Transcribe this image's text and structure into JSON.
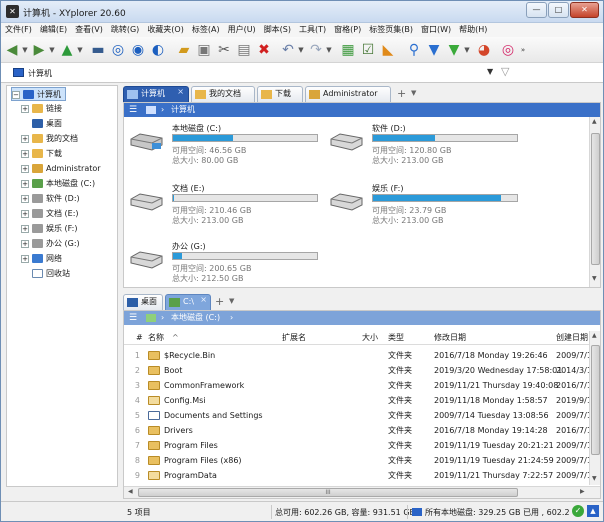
{
  "window": {
    "title": "计算机 - XYplorer 20.60",
    "min": "—",
    "max": "□",
    "close": "✕"
  },
  "menu": [
    "文件(F)",
    "编辑(E)",
    "查看(V)",
    "跳转(G)",
    "收藏夹(O)",
    "标签(A)",
    "用户(U)",
    "脚本(S)",
    "工具(T)",
    "窗格(P)",
    "标签页集(B)",
    "窗口(W)",
    "帮助(H)"
  ],
  "address": {
    "text": "计算机",
    "dropdown": "▼",
    "filter_icon": "funnel-icon"
  },
  "tree": [
    {
      "label": "计算机",
      "icon": "computer-icon",
      "exp": "−"
    },
    {
      "label": "链接",
      "icon": "link-folder-icon",
      "exp": "+"
    },
    {
      "label": "桌面",
      "icon": "desktop-icon",
      "exp": ""
    },
    {
      "label": "我的文档",
      "icon": "documents-icon",
      "exp": "+"
    },
    {
      "label": "下载",
      "icon": "downloads-icon",
      "exp": "+"
    },
    {
      "label": "Administrator",
      "icon": "user-folder-icon",
      "exp": "+"
    },
    {
      "label": "本地磁盘 (C:)",
      "icon": "system-drive-icon",
      "exp": "+"
    },
    {
      "label": "软件 (D:)",
      "icon": "drive-icon",
      "exp": "+"
    },
    {
      "label": "文档 (E:)",
      "icon": "drive-icon",
      "exp": "+"
    },
    {
      "label": "娱乐 (F:)",
      "icon": "drive-icon",
      "exp": "+"
    },
    {
      "label": "办公 (G:)",
      "icon": "drive-icon",
      "exp": "+"
    },
    {
      "label": "网络",
      "icon": "network-icon",
      "exp": "+"
    },
    {
      "label": "回收站",
      "icon": "recycle-bin-icon",
      "exp": ""
    }
  ],
  "pane1": {
    "tabs": [
      {
        "label": "计算机",
        "close": "×"
      },
      {
        "label": "我的文档"
      },
      {
        "label": "下载"
      },
      {
        "label": "Administrator"
      }
    ],
    "tab_add": "+",
    "tab_menu": "▼",
    "breadcrumb": "计算机",
    "drives": [
      {
        "name": "本地磁盘 (C:)",
        "fill": 0.42,
        "free": "可用空间: 46.56 GB",
        "total": "总大小: 80.00 GB"
      },
      {
        "name": "软件 (D:)",
        "fill": 0.43,
        "free": "可用空间: 120.80 GB",
        "total": "总大小: 213.00 GB"
      },
      {
        "name": "文档 (E:)",
        "fill": 0.01,
        "free": "可用空间: 210.46 GB",
        "total": "总大小: 213.00 GB"
      },
      {
        "name": "娱乐 (F:)",
        "fill": 0.89,
        "free": "可用空间: 23.79 GB",
        "total": "总大小: 213.00 GB"
      },
      {
        "name": "办公 (G:)",
        "fill": 0.06,
        "free": "可用空间: 200.65 GB",
        "total": "总大小: 212.50 GB"
      }
    ]
  },
  "pane2": {
    "tabs": [
      {
        "label": "桌面"
      },
      {
        "label": "C:\\",
        "close": "×"
      }
    ],
    "tab_add": "+",
    "tab_menu": "▼",
    "breadcrumb": "本地磁盘 (C:)",
    "columns": {
      "num": "#",
      "name": "名称",
      "sort": "^",
      "ext": "扩展名",
      "size": "大小",
      "type": "类型",
      "date": "修改日期",
      "created": "创建日期"
    },
    "rows": [
      {
        "n": "1",
        "name": "$Recycle.Bin",
        "type": "文件夹",
        "date": "2016/7/18 Monday 19:26:46",
        "created": "2009/7/1"
      },
      {
        "n": "2",
        "name": "Boot",
        "type": "文件夹",
        "date": "2019/3/20 Wednesday 17:58:01",
        "created": "2014/3/1"
      },
      {
        "n": "3",
        "name": "CommonFramework",
        "type": "文件夹",
        "date": "2019/11/21 Thursday 19:40:08",
        "created": "2016/7/1"
      },
      {
        "n": "4",
        "name": "Config.Msi",
        "type": "文件夹",
        "date": "2019/11/18 Monday 1:58:57",
        "created": "2019/9/1"
      },
      {
        "n": "5",
        "name": "Documents and Settings",
        "type": "文件夹",
        "date": "2009/7/14 Tuesday 13:08:56",
        "created": "2009/7/1"
      },
      {
        "n": "6",
        "name": "Drivers",
        "type": "文件夹",
        "date": "2016/7/18 Monday 19:14:28",
        "created": "2016/7/1"
      },
      {
        "n": "7",
        "name": "Program Files",
        "type": "文件夹",
        "date": "2019/11/19 Tuesday 20:21:21",
        "created": "2009/7/1"
      },
      {
        "n": "8",
        "name": "Program Files (x86)",
        "type": "文件夹",
        "date": "2019/11/19 Tuesday 21:24:59",
        "created": "2009/7/1"
      },
      {
        "n": "9",
        "name": "ProgramData",
        "type": "文件夹",
        "date": "2019/11/21 Thursday 7:22:57",
        "created": "2009/7/1"
      }
    ],
    "hscroll_grip": "III"
  },
  "status": {
    "items": "5 项目",
    "space": "总可用: 602.26 GB, 容量: 931.51 GB",
    "local": "所有本地磁盘: 329.25 GB 已用 , 602.2"
  },
  "colors": {
    "accent": "#2f5fb0",
    "breadcrumb": "#3a70c8",
    "bar": "#2b9ad9"
  }
}
